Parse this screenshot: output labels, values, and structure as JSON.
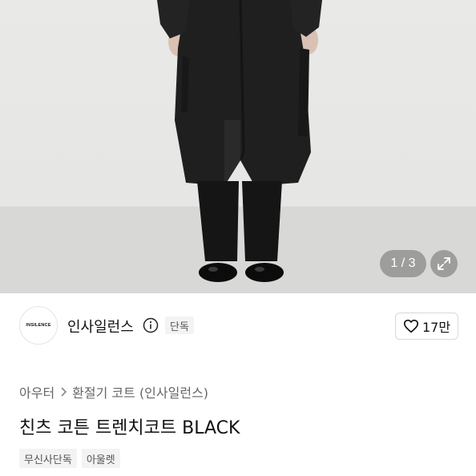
{
  "gallery": {
    "counter": "1 / 3",
    "expand_icon": "expand-icon"
  },
  "brand": {
    "logo_text": "INSILENCE",
    "name": "인사일런스",
    "info_icon": "info-icon",
    "badge": "단독",
    "likes": "17만",
    "like_icon": "heart-icon"
  },
  "breadcrumb": {
    "items": [
      "아우터",
      "환절기 코트 (인사일런스)"
    ],
    "separator_icon": "chevron-right-icon"
  },
  "product": {
    "title": "친츠 코튼 트렌치코트 BLACK"
  },
  "tags": [
    "무신사단독",
    "아울렛"
  ],
  "colors": {
    "badge_bg": "#f3f3f3",
    "text_primary": "#111111",
    "text_secondary": "#666666"
  }
}
